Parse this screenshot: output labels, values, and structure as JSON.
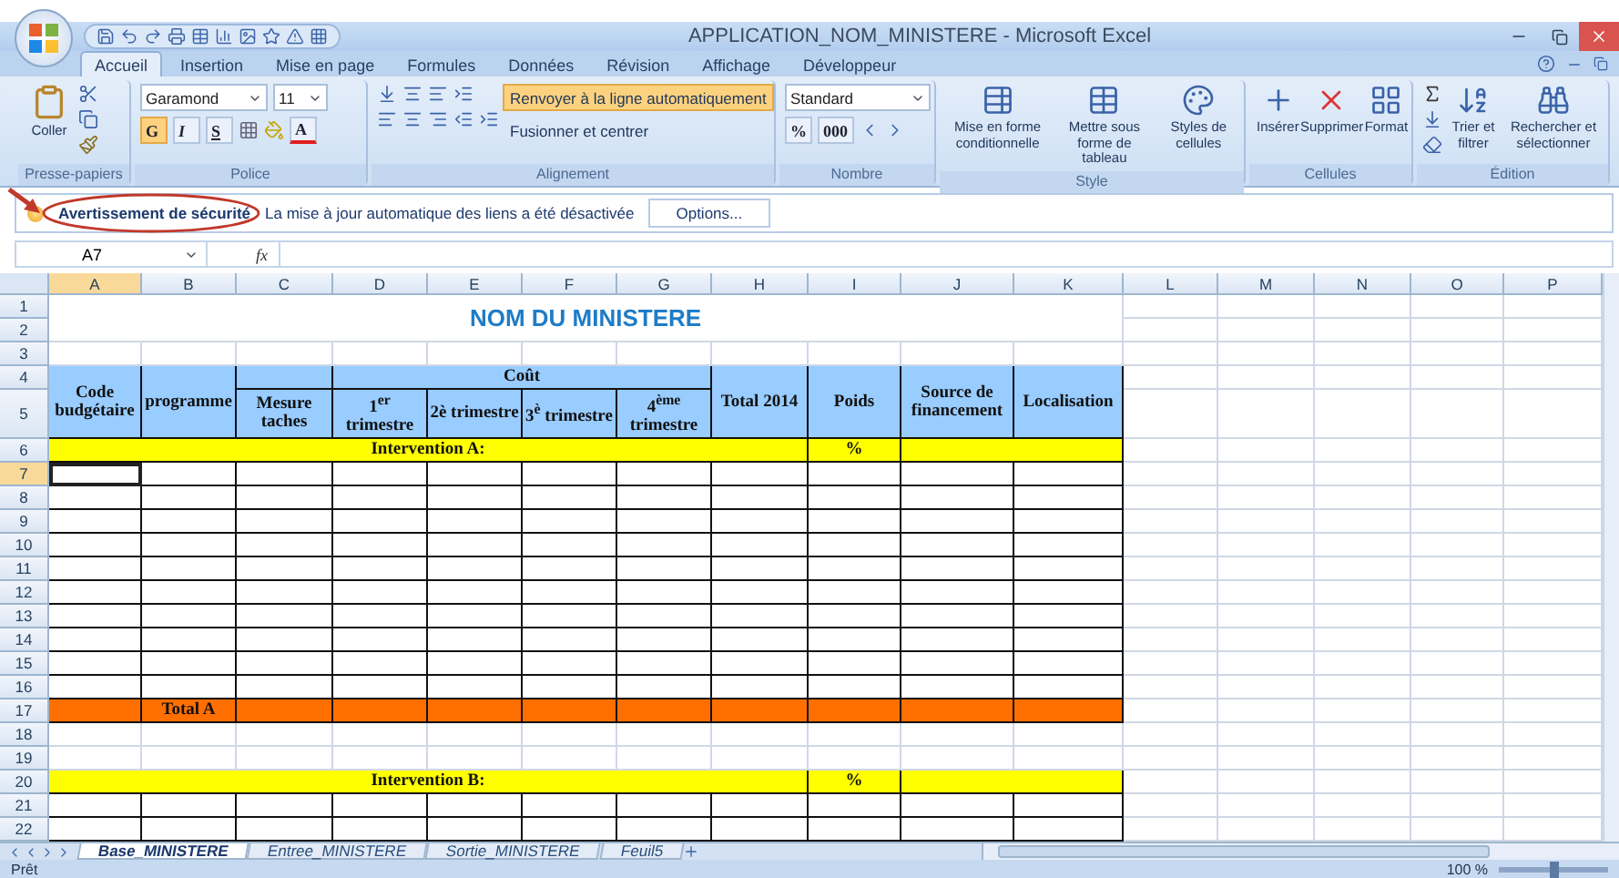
{
  "window": {
    "title": "APPLICATION_NOM_MINISTERE - Microsoft Excel"
  },
  "ribbon_tabs": [
    {
      "label": "Accueil",
      "selected": true
    },
    {
      "label": "Insertion",
      "selected": false
    },
    {
      "label": "Mise en page",
      "selected": false
    },
    {
      "label": "Formules",
      "selected": false
    },
    {
      "label": "Données",
      "selected": false
    },
    {
      "label": "Révision",
      "selected": false
    },
    {
      "label": "Affichage",
      "selected": false
    },
    {
      "label": "Développeur",
      "selected": false
    }
  ],
  "ribbon": {
    "clipboard": {
      "name": "Presse-papiers",
      "paste": "Coller"
    },
    "font": {
      "name": "Police",
      "font_name": "Garamond",
      "font_size": "11",
      "bold": {
        "label": "G",
        "on": true
      },
      "italic": {
        "label": "I",
        "on": false
      },
      "underline": {
        "label": "S",
        "on": false
      },
      "font_color": "A"
    },
    "alignment": {
      "name": "Alignement",
      "wrap": {
        "label": "Renvoyer à la ligne automatiquement",
        "on": true
      },
      "merge": {
        "label": "Fusionner et centrer",
        "on": false
      }
    },
    "number": {
      "name": "Nombre",
      "format": "Standard",
      "percent": "%",
      "thousands": "000"
    },
    "style": {
      "name": "Style",
      "buttons": [
        "Mise en forme conditionnelle",
        "Mettre sous forme de tableau",
        "Styles de cellules"
      ]
    },
    "cells": {
      "name": "Cellules",
      "buttons": [
        "Insérer",
        "Supprimer",
        "Format"
      ]
    },
    "editing": {
      "name": "Édition",
      "buttons": [
        "Trier et filtrer",
        "Rechercher et sélectionner"
      ]
    }
  },
  "security_bar": {
    "title": "Avertissement de sécurité",
    "message": "La mise à jour automatique des liens a été désactivée",
    "button": "Options..."
  },
  "formula_bar": {
    "name_box": "A7",
    "function_label": "fx"
  },
  "sheet": {
    "columns": [
      "A",
      "B",
      "C",
      "D",
      "E",
      "F",
      "G",
      "H",
      "I",
      "J",
      "K",
      "L",
      "M",
      "N",
      "O",
      "P"
    ],
    "title": "NOM DU MINISTERE",
    "cost_group": "Coût",
    "headers": [
      {
        "label": "Code budgétaire",
        "kind": "tall"
      },
      {
        "label": "programme",
        "kind": "tall"
      },
      {
        "label": "Mesure taches",
        "kind": "lower"
      },
      {
        "label": "1$^{er}$ trimestre",
        "kind": "grouped"
      },
      {
        "label": "2è trimestre",
        "kind": "grouped"
      },
      {
        "label": "3$^{è}$ trimestre",
        "kind": "grouped"
      },
      {
        "label": "4$^{ème}$ trimestre",
        "kind": "grouped"
      },
      {
        "label": "Total 2014",
        "kind": "tall"
      },
      {
        "label": "Poids",
        "kind": "tall"
      },
      {
        "label": "Source de financement",
        "kind": "tall"
      },
      {
        "label": "Localisation",
        "kind": "tall"
      }
    ],
    "rows": [
      {
        "number": "1",
        "kind": "title"
      },
      {
        "number": "2",
        "kind": "title_cont"
      },
      {
        "number": "3",
        "kind": "blank"
      },
      {
        "number": "4",
        "kind": "header_top"
      },
      {
        "number": "5",
        "kind": "header_bottom"
      },
      {
        "number": "6",
        "kind": "intervention",
        "label": "Intervention A:",
        "weight": "%"
      },
      {
        "number": "7",
        "kind": "entry",
        "active": true
      },
      {
        "number": "8",
        "kind": "entry",
        "active": false
      },
      {
        "number": "9",
        "kind": "entry",
        "active": false
      },
      {
        "number": "10",
        "kind": "entry",
        "active": false
      },
      {
        "number": "11",
        "kind": "entry",
        "active": false
      },
      {
        "number": "12",
        "kind": "entry",
        "active": false
      },
      {
        "number": "13",
        "kind": "entry",
        "active": false
      },
      {
        "number": "14",
        "kind": "entry",
        "active": false
      },
      {
        "number": "15",
        "kind": "entry",
        "active": false
      },
      {
        "number": "16",
        "kind": "entry",
        "active": false
      },
      {
        "number": "17",
        "kind": "total",
        "label": "Total A"
      },
      {
        "number": "18",
        "kind": "blank"
      },
      {
        "number": "19",
        "kind": "blank"
      },
      {
        "number": "20",
        "kind": "intervention",
        "label": "Intervention B:",
        "weight": "%"
      },
      {
        "number": "21",
        "kind": "entry",
        "active": false
      },
      {
        "number": "22",
        "kind": "entry",
        "active": false
      }
    ]
  },
  "sheet_tabs": [
    {
      "label": "Base_MINISTERE",
      "selected": true
    },
    {
      "label": "Entree_MINISTERE",
      "selected": false
    },
    {
      "label": "Sortie_MINISTERE",
      "selected": false
    },
    {
      "label": "Feuil5",
      "selected": false
    }
  ],
  "status_bar": {
    "status": "Prêt",
    "zoom": "100 %",
    "zoom_slider": {
      "level": 0.5
    }
  }
}
